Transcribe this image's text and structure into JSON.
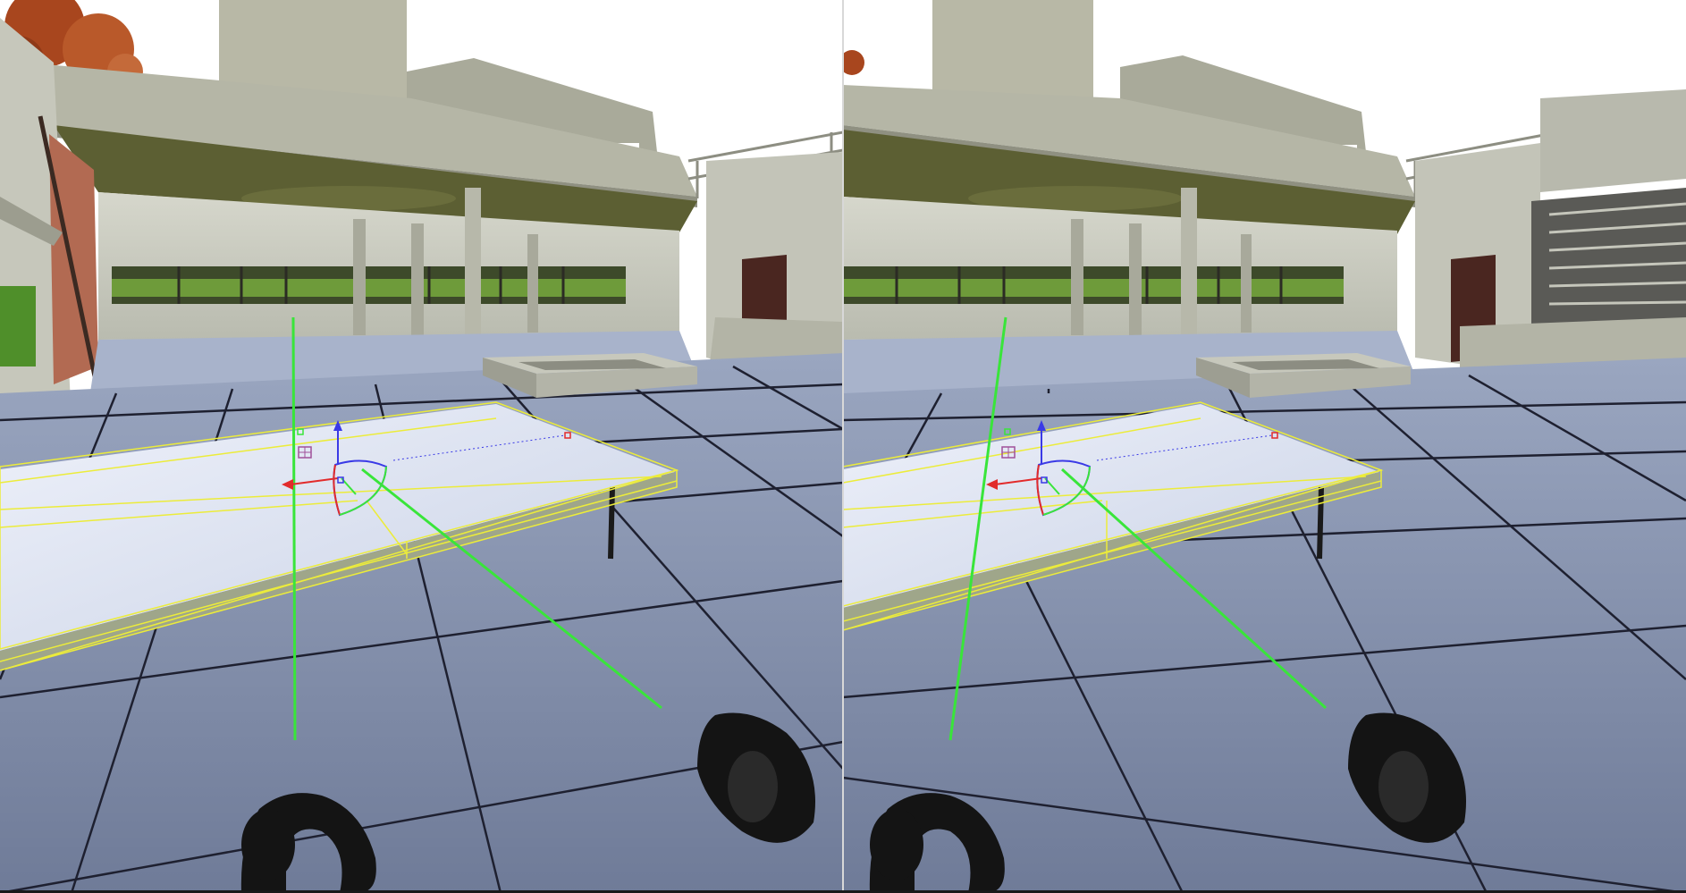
{
  "app": {
    "view_mode": "stereo-vr",
    "eyes": [
      "left-eye",
      "right-eye"
    ]
  },
  "scene": {
    "selected_object": "table",
    "selection_color": "#ecec3a",
    "laser_color": "#39e53a",
    "gizmo_colors": {
      "x_axis": "#e22b2b",
      "y_axis": "#3a3ae6",
      "z_axis": "#39e53a"
    },
    "sky_color": "#ffffff",
    "floor_color": "#7e8aa8",
    "wall_color": "#c8c9bc",
    "ceiling_color": "#5c5f33"
  },
  "controllers": {
    "left": "left-touch-controller",
    "right": "right-touch-controller"
  }
}
